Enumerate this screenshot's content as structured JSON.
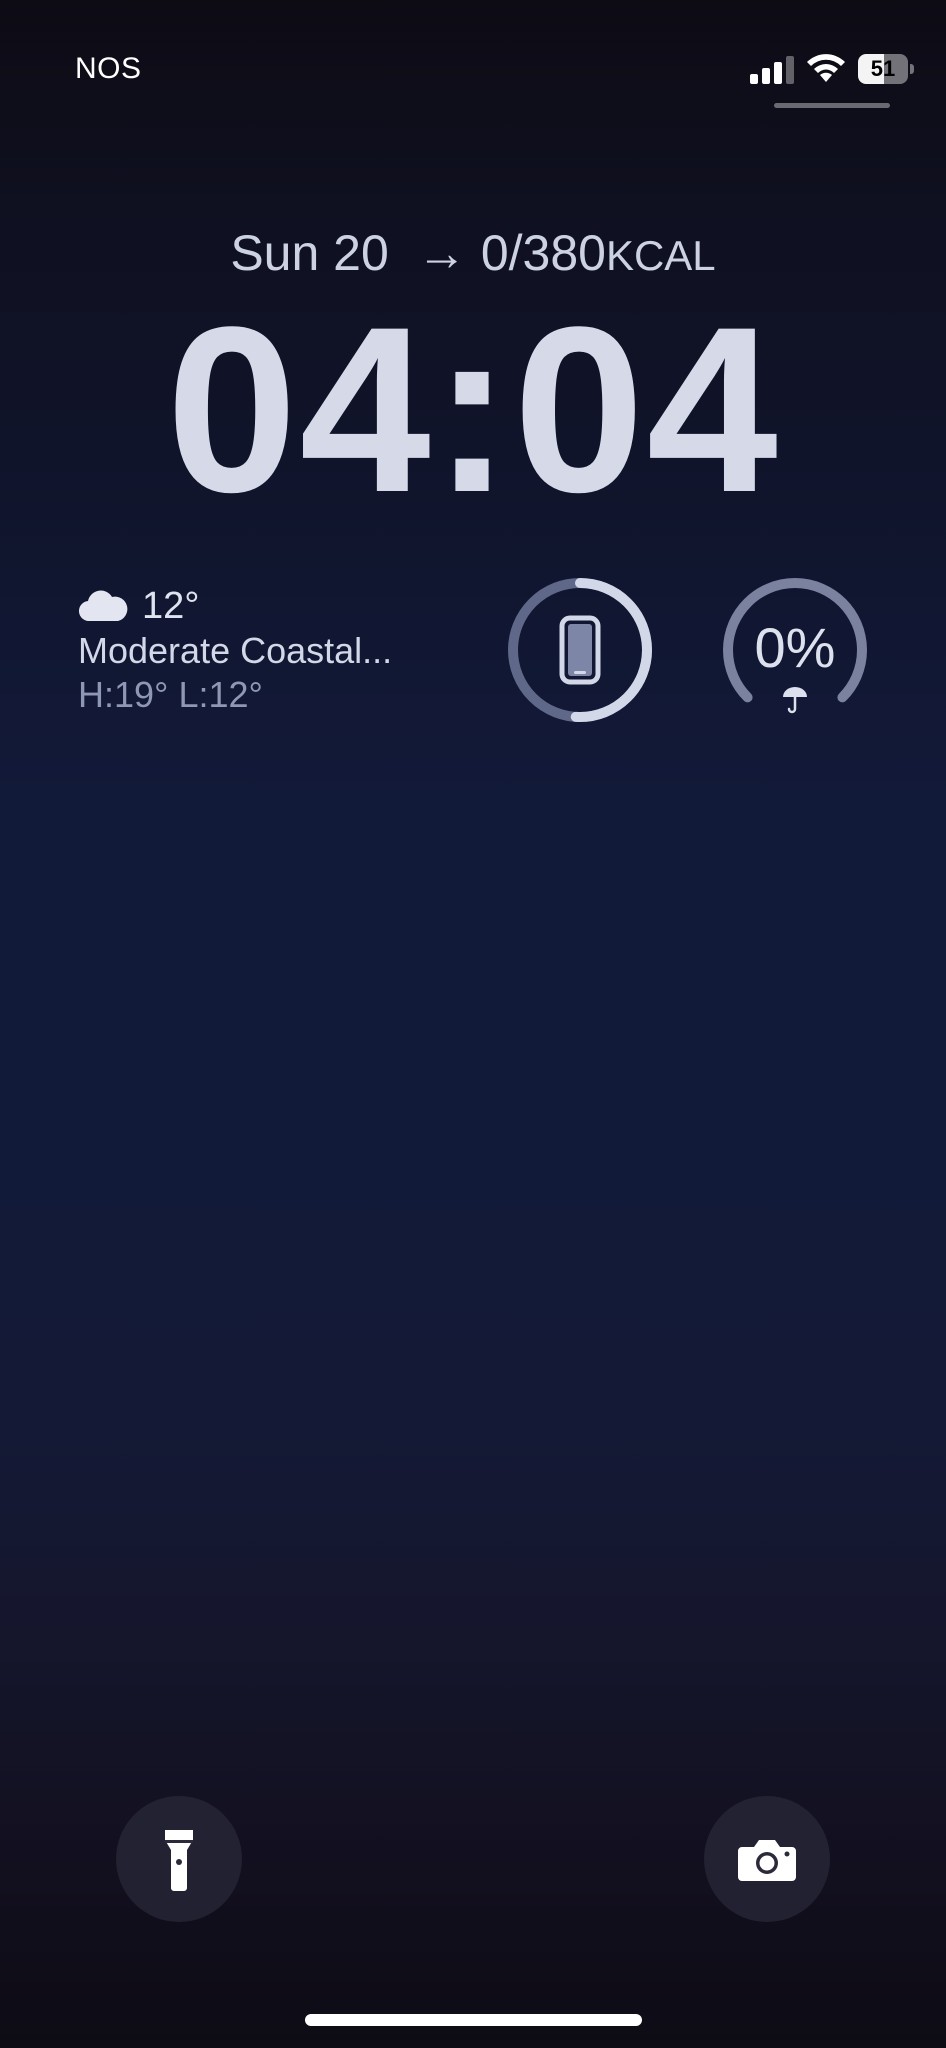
{
  "status_bar": {
    "carrier": "NOS",
    "battery_level": "51",
    "battery_fraction": 0.51
  },
  "lock_screen": {
    "date": "Sun 20",
    "calories": "0/380",
    "calories_unit": "KCAL",
    "time": "04:04"
  },
  "weather": {
    "temperature": "12°",
    "condition": "Moderate Coastal...",
    "high_low": "H:19° L:12°",
    "icon": "cloud-icon"
  },
  "widgets": {
    "device_battery": {
      "icon": "iphone-icon",
      "level_fraction": 0.51
    },
    "rain_chance": {
      "label": "0%",
      "icon": "umbrella-icon"
    }
  },
  "bottom_buttons": {
    "flashlight_icon": "flashlight-icon",
    "camera_icon": "camera-icon"
  },
  "colors": {
    "text_primary": "#d5d9e8",
    "text_secondary": "#8e97b5",
    "ring_track": "#5f6888",
    "ring_fill": "#d3d8e8"
  }
}
